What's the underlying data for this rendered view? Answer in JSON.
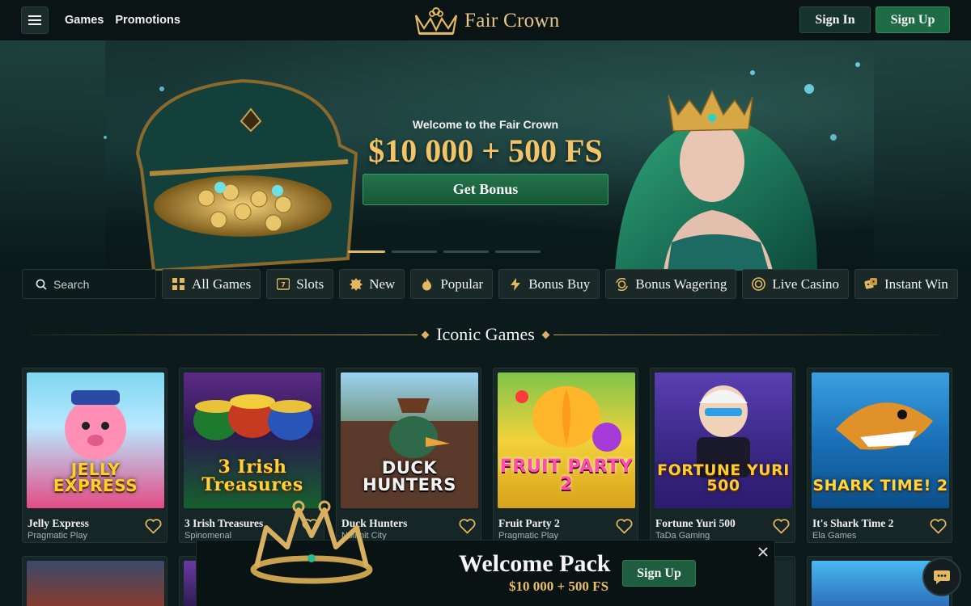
{
  "header": {
    "nav": [
      "Games",
      "Promotions"
    ],
    "logo_text": "Fair Crown",
    "sign_in": "Sign In",
    "sign_up": "Sign Up"
  },
  "hero": {
    "welcome": "Welcome to the Fair Crown",
    "amount": "$10 000 + 500 FS",
    "button": "Get Bonus",
    "active_slide": 1,
    "slide_count": 4
  },
  "search": {
    "placeholder": "Search"
  },
  "categories": [
    {
      "label": "All Games",
      "icon": "grid-icon"
    },
    {
      "label": "Slots",
      "icon": "slot-777-icon"
    },
    {
      "label": "New",
      "icon": "new-badge-icon"
    },
    {
      "label": "Popular",
      "icon": "flame-icon"
    },
    {
      "label": "Bonus Buy",
      "icon": "lightning-icon"
    },
    {
      "label": "Bonus Wagering",
      "icon": "coin-exchange-icon"
    },
    {
      "label": "Live Casino",
      "icon": "casino-chip-icon"
    },
    {
      "label": "Instant Win",
      "icon": "dice-icon"
    }
  ],
  "section_title": "Iconic Games",
  "games": [
    {
      "title": "Jelly Express",
      "provider": "Pragmatic Play",
      "art": "JELLY EXPRESS",
      "bg": [
        "#7fd7f0",
        "#e24c86"
      ],
      "art_color": "#ffd02a"
    },
    {
      "title": "3 Irish Treasures",
      "provider": "Spinomenal",
      "art": "3 Irish Treasures",
      "bg": [
        "#5c2a86",
        "#15602d"
      ],
      "art_color": "#ffd23a"
    },
    {
      "title": "Duck Hunters",
      "provider": "Nolimit City",
      "art": "DUCK HUNTERS",
      "bg": [
        "#9dd3f2",
        "#3b4a3a"
      ],
      "art_color": "#f2f2f2"
    },
    {
      "title": "Fruit Party 2",
      "provider": "Pragmatic Play",
      "art": "FRUIT PARTY 2",
      "bg": [
        "#7fc44a",
        "#d9a21a"
      ],
      "art_color": "#ff4fa8"
    },
    {
      "title": "Fortune Yuri 500",
      "provider": "TaDa Gaming",
      "art": "FORTUNE YURI 500",
      "bg": [
        "#5a3fb1",
        "#2a1c6e"
      ],
      "art_color": "#ffcc33"
    },
    {
      "title": "It's Shark Time 2",
      "provider": "Ela Games",
      "art": "SHARK TIME! 2",
      "bg": [
        "#3aa0e0",
        "#0c4f8a"
      ],
      "art_color": "#ffd73b"
    }
  ],
  "welcome_pack": {
    "title": "Welcome Pack",
    "subtitle": "$10 000 + 500 FS",
    "button": "Sign Up"
  },
  "colors": {
    "accent_gold": "#e2b860",
    "button_green": "#1f6b46",
    "background": "#0c1a1b"
  }
}
